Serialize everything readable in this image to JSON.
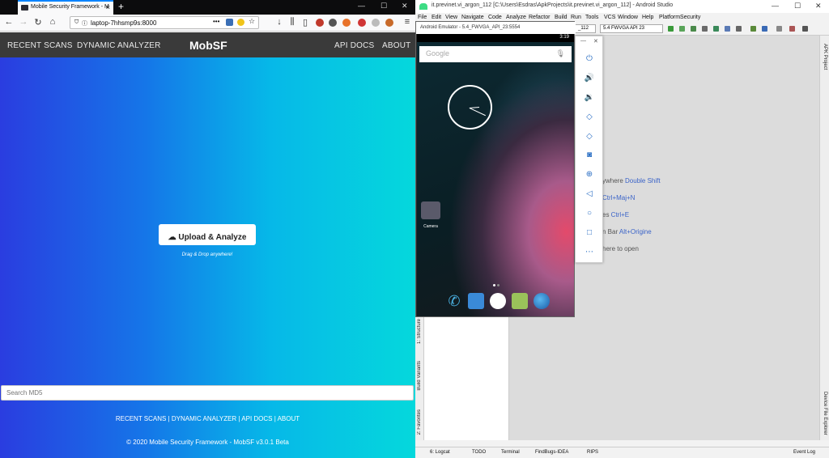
{
  "browser": {
    "tab_title": "Mobile Security Framework - M",
    "url": "laptop-7hhsmp9s:8000"
  },
  "mobsf": {
    "nav_left": [
      "RECENT SCANS",
      "DYNAMIC ANALYZER"
    ],
    "logo": "MobSF",
    "nav_right": [
      "API DOCS",
      "ABOUT"
    ],
    "upload_label": "Upload & Analyze",
    "drag_text": "Drag & Drop anywhere!",
    "search_placeholder": "Search MD5",
    "footer_links": "RECENT SCANS | DYNAMIC ANALYZER | API DOCS | ABOUT",
    "copyright": "© 2020 Mobile Security Framework - MobSF v3.0.1 Beta",
    "colors": {
      "gradient_start": "#2a3de0",
      "gradient_end": "#05d8dc",
      "nav_bg": "#3a3a3a"
    }
  },
  "studio": {
    "title": "it.previnet.vi_argon_112 [C:\\Users\\Esdras\\ApkProjects\\it.previnet.vi_argon_112] - Android Studio",
    "menu": [
      "File",
      "Edit",
      "View",
      "Navigate",
      "Code",
      "Analyze",
      "Refactor",
      "Build",
      "Run",
      "Tools",
      "VCS",
      "Window",
      "Help",
      "PlatformSecurity"
    ],
    "config_select": "_112",
    "device_select": "5.4  FWVGA API 23",
    "hints": [
      {
        "pre": "ywhere ",
        "key": "Double Shift"
      },
      {
        "pre": "",
        "key": "Ctrl+Maj+N"
      },
      {
        "pre": "es ",
        "key": "Ctrl+E"
      },
      {
        "pre": "n Bar ",
        "key": "Alt+Origine"
      },
      {
        "pre": "here to open",
        "key": ""
      }
    ],
    "left_tabs": [
      "1: Structure",
      "Build Variants",
      "2: Favorites"
    ],
    "right_tabs": [
      "APK Project",
      "Device File Explorer"
    ],
    "status_tabs": [
      "6: Logcat",
      "TODO",
      "Terminal",
      "FindBugs-IDEA",
      "RIPS"
    ],
    "event_log": "Event Log"
  },
  "emulator": {
    "title": "Android Emulator - 5.4_FWVGA_API_23:5554",
    "time": "3:19",
    "search_placeholder": "Google",
    "camera_label": "Camera"
  }
}
